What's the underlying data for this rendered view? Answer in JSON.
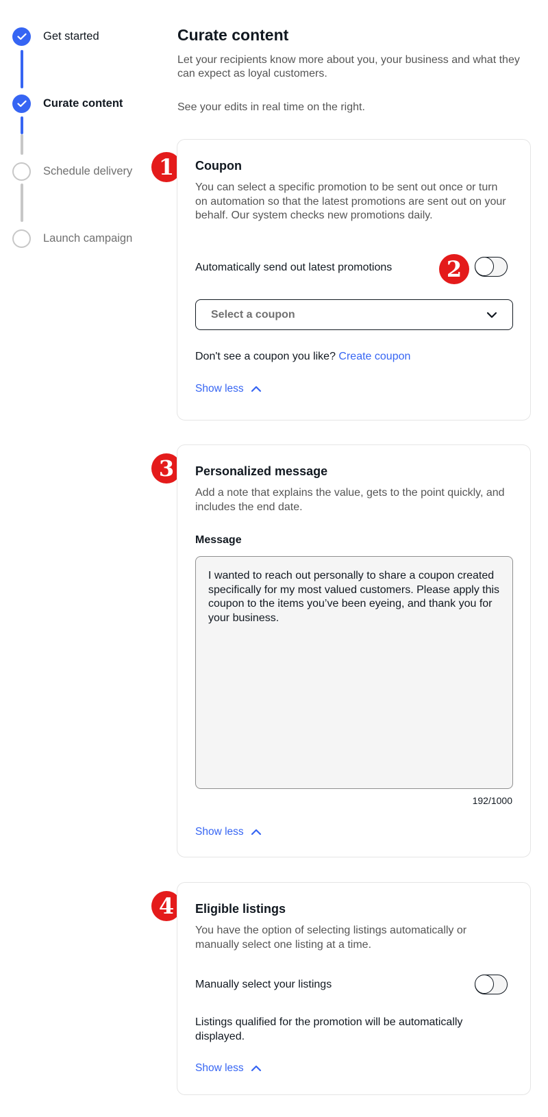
{
  "stepper": {
    "steps": [
      {
        "label": "Get started",
        "state": "done"
      },
      {
        "label": "Curate content",
        "state": "active"
      },
      {
        "label": "Schedule delivery",
        "state": "todo"
      },
      {
        "label": "Launch campaign",
        "state": "todo"
      }
    ]
  },
  "header": {
    "title": "Curate content",
    "description": "Let your recipients know more about you, your business and what they can expect as loyal customers.",
    "note": "See your edits in real time on the right."
  },
  "coupon": {
    "badge": "1",
    "title": "Coupon",
    "description": "You can select a specific promotion to be sent out once or turn on automation so that the latest promotions are sent out on your behalf. Our system checks new promotions daily.",
    "auto_label": "Automatically send out latest promotions",
    "auto_badge": "2",
    "auto_enabled": false,
    "select_placeholder": "Select a coupon",
    "prompt_text": "Don't see a coupon you like?",
    "create_link": "Create coupon",
    "show_less": "Show less"
  },
  "message": {
    "badge": "3",
    "title": "Personalized message",
    "description": "Add a note that explains the value, gets to the point quickly, and includes the end date.",
    "field_label": "Message",
    "value": "I wanted to reach out personally to share a coupon created specifically for my most valued customers. Please apply this coupon to the items you’ve been eyeing, and thank you for your business.",
    "char_count": "192/1000",
    "show_less": "Show less"
  },
  "listings": {
    "badge": "4",
    "title": "Eligible listings",
    "description": "You have the option of selecting listings automatically or manually select one listing at a time.",
    "manual_label": "Manually select your listings",
    "manual_enabled": false,
    "info_text": "Listings qualified for the promotion will be automatically displayed.",
    "show_less": "Show less"
  },
  "colors": {
    "accent": "#3665f3",
    "badge": "#e41b1b",
    "muted_text": "#555555",
    "border": "#e5e5e5"
  }
}
